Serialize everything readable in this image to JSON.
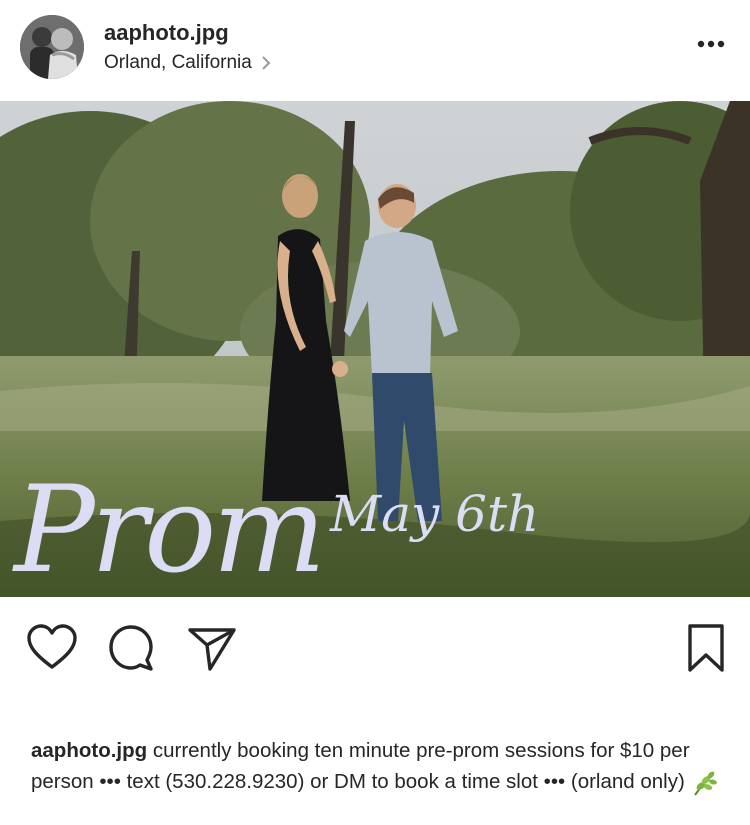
{
  "post": {
    "username": "aaphoto.jpg",
    "location": "Orland, California",
    "photo_overlay": {
      "title": "Prom",
      "date": "May 6th"
    },
    "caption": {
      "username": "aaphoto.jpg",
      "text": " currently booking ten minute pre-prom sessions for $10 per person ••• text (530.228.9230) or DM to book a time slot ••• (orland only)",
      "emoji": "herb-emoji"
    }
  },
  "icons": {
    "more": "more-horizontal-icon",
    "like": "heart-icon",
    "comment": "comment-bubble-icon",
    "share": "paper-plane-icon",
    "save": "bookmark-icon",
    "location_chevron": "chevron-right-icon"
  },
  "colors": {
    "text": "#262626",
    "secondary": "#8e8e8e",
    "overlay_script": "#dcdcf5"
  }
}
